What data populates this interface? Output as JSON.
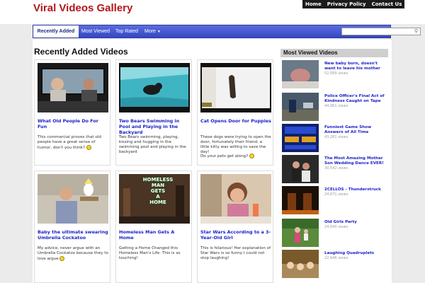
{
  "site": {
    "title": "Viral Videos Gallery"
  },
  "toplinks": [
    "Home",
    "Privacy Policy",
    "Contact Us"
  ],
  "nav": {
    "items": [
      "Recently Added",
      "Most Viewed",
      "Top Rated",
      "More"
    ],
    "search_placeholder": ""
  },
  "main": {
    "section_title": "Recently Added Videos",
    "cards": [
      {
        "title": "What Old People Do For Fun",
        "desc": "This commercial proves that old people have a great sense of humor, don't you think?"
      },
      {
        "title": "Two Bears Swimming in Pool and Playing in the Backyard",
        "desc": "Two Bears swimming, playing, kissing and hugging in the swimming pool and playing in the backyard"
      },
      {
        "title": "Cat Opens Door for Puppies",
        "desc": "These dogs were trying to open the door, fortunately their friend, a little kitty was willing to save the day!",
        "desc2": "Do your pets get along?"
      },
      {
        "title": "Baby the ultimate swearing Umbrella Cockatoo",
        "desc": "My advice, never argue with  an Umbrella Cockatoo because they to love argue"
      },
      {
        "title": "Homeless Man Gets A Home",
        "desc": "Getting a Home Changed this Homeless Man's Life. This is so touching!",
        "thumb_text": [
          "HOMELESS",
          "MAN",
          "GETS",
          "A",
          "HOME"
        ]
      },
      {
        "title": "Star Wars According to a 3-Year-Old Girl",
        "desc": "This is hilarious! Her explanation of Star Wars is so funny I could not stop laughing!"
      }
    ]
  },
  "sidebar": {
    "title": "Most Viewed Videos",
    "items": [
      {
        "title": "New baby born, doesn't want to leave his mother",
        "views": "52,589 views"
      },
      {
        "title": "Police Officer's Final Act of Kindness Caught on Tape",
        "views": "44,961 views"
      },
      {
        "title": "Funniest Game Show Answers of All Time",
        "views": "43,281 views"
      },
      {
        "title": "The Most Amazing Mother Son Wedding Dance EVER!",
        "views": "30,542 views"
      },
      {
        "title": "2CELLOS - Thunderstruck",
        "views": "24,671 views"
      },
      {
        "title": "Old Girls Party",
        "views": "24,040 views"
      },
      {
        "title": "Laughing Quadruplets",
        "views": "22,946 views"
      }
    ]
  }
}
